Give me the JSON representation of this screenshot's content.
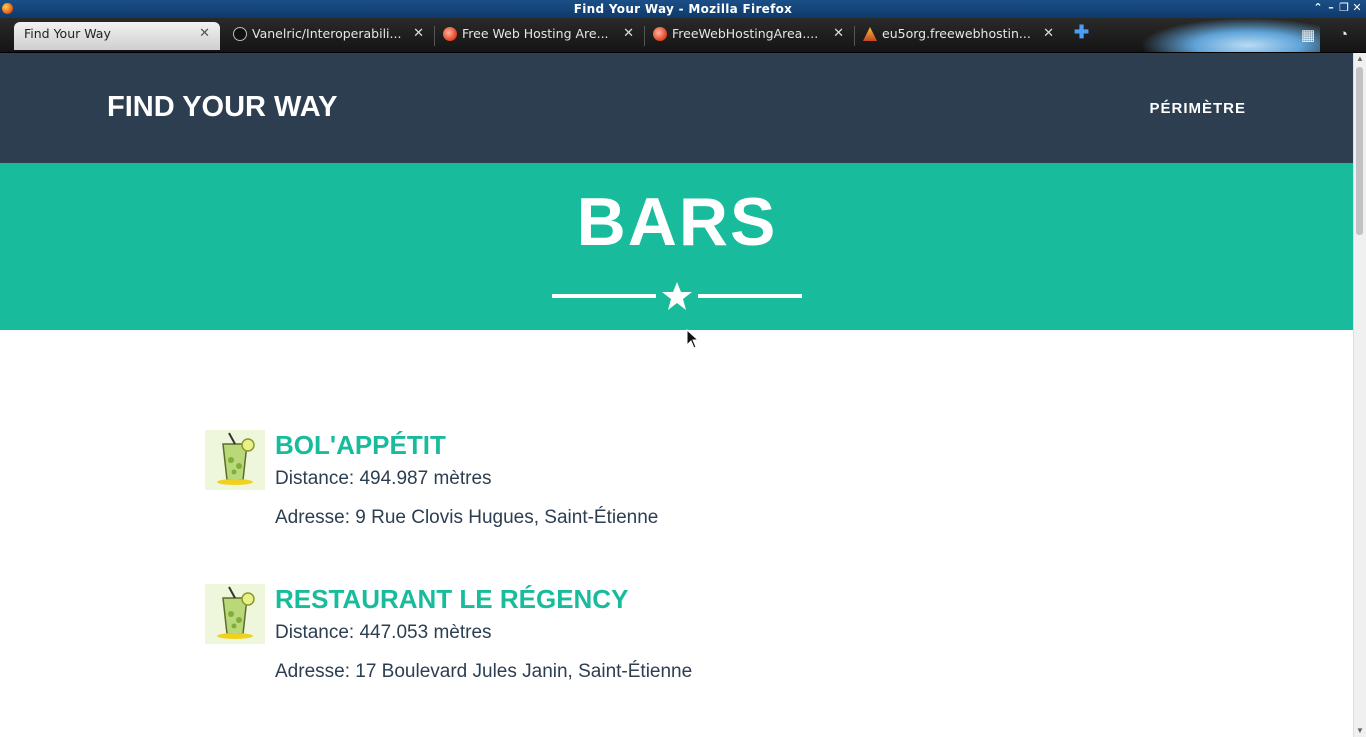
{
  "window": {
    "title": "Find Your Way - Mozilla Firefox"
  },
  "tabs": [
    {
      "label": "Find Your Way",
      "favicon": "firefox-page-icon",
      "active": true
    },
    {
      "label": "Vanelric/Interoperabili...",
      "favicon": "github-icon",
      "active": false
    },
    {
      "label": "Free Web Hosting Are...",
      "favicon": "freewebhostingarea-icon",
      "active": false
    },
    {
      "label": "FreeWebHostingArea....",
      "favicon": "freewebhostingarea-icon",
      "active": false
    },
    {
      "label": "eu5org.freewebhostin...",
      "favicon": "eu5-icon",
      "active": false
    }
  ],
  "site": {
    "brand": "FIND YOUR WAY",
    "nav_link": "PÉRIMÈTRE",
    "colors": {
      "navbar": "#2c3e50",
      "accent": "#18bc9c",
      "text": "#2c3e50"
    }
  },
  "hero": {
    "title": "BARS"
  },
  "results": [
    {
      "name": "BOL'APPÉTIT",
      "distance": "Distance: 494.987 mètres",
      "address": "Adresse: 9 Rue Clovis Hugues, Saint-Étienne",
      "icon": "cocktail-glass-icon"
    },
    {
      "name": "RESTAURANT LE RÉGENCY",
      "distance": "Distance: 447.053 mètres",
      "address": "Adresse: 17 Boulevard Jules Janin, Saint-Étienne",
      "icon": "cocktail-glass-icon"
    }
  ]
}
